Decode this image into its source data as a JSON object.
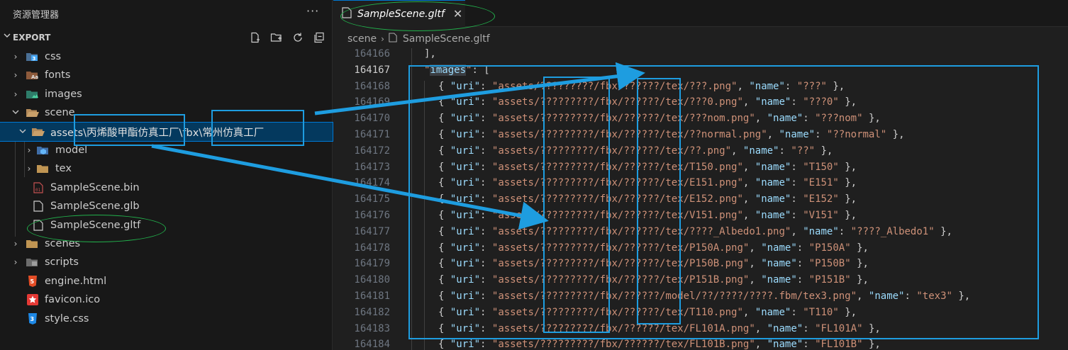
{
  "sidebar": {
    "title": "资源管理器",
    "more": "···",
    "section": "EXPORT",
    "items": [
      {
        "label": "css",
        "icon": "css-folder-icon",
        "indent": 0,
        "expanded": false
      },
      {
        "label": "fonts",
        "icon": "fonts-folder-icon",
        "indent": 0,
        "expanded": false
      },
      {
        "label": "images",
        "icon": "images-folder-icon",
        "indent": 0,
        "expanded": false
      },
      {
        "label": "scene",
        "icon": "folder-open-icon",
        "indent": 0,
        "expanded": true
      },
      {
        "label": "assets\\丙烯酸甲酯仿真工厂\\fbx\\常州仿真工厂",
        "icon": "folder-open-icon",
        "indent": 1,
        "expanded": true,
        "selected": true
      },
      {
        "label": "model",
        "icon": "model-folder-icon",
        "indent": 2,
        "expanded": false
      },
      {
        "label": "tex",
        "icon": "folder-icon",
        "indent": 2,
        "expanded": false
      },
      {
        "label": "SampleScene.bin",
        "icon": "binary-file-icon",
        "indent": 1
      },
      {
        "label": "SampleScene.glb",
        "icon": "file-icon",
        "indent": 1
      },
      {
        "label": "SampleScene.gltf",
        "icon": "file-icon",
        "indent": 1
      },
      {
        "label": "scenes",
        "icon": "folder-icon",
        "indent": 0,
        "expanded": false
      },
      {
        "label": "scripts",
        "icon": "scripts-folder-icon",
        "indent": 0,
        "expanded": false
      },
      {
        "label": "engine.html",
        "icon": "html-file-icon",
        "indent": 0
      },
      {
        "label": "favicon.ico",
        "icon": "favicon-star-icon",
        "indent": 0
      },
      {
        "label": "style.css",
        "icon": "css-file-icon",
        "indent": 0
      }
    ]
  },
  "editor": {
    "tab_label": "SampleScene.gltf",
    "breadcrumb": [
      "scene",
      "SampleScene.gltf"
    ],
    "lines": [
      {
        "n": "164166",
        "text": "],"
      },
      {
        "n": "164167",
        "text": "\"images\": [",
        "current": true
      },
      {
        "n": "164168",
        "uri": "assets/?????????/fbx/??????/tex/???.png",
        "name": "???"
      },
      {
        "n": "164169",
        "uri": "assets/?????????/fbx/??????/tex/???0.png",
        "name": "???0"
      },
      {
        "n": "164170",
        "uri": "assets/?????????/fbx/??????/tex/???nom.png",
        "name": "???nom"
      },
      {
        "n": "164171",
        "uri": "assets/?????????/fbx/??????/tex/??normal.png",
        "name": "??normal"
      },
      {
        "n": "164172",
        "uri": "assets/?????????/fbx/??????/tex/??.png",
        "name": "??"
      },
      {
        "n": "164173",
        "uri": "assets/?????????/fbx/??????/tex/T150.png",
        "name": "T150"
      },
      {
        "n": "164174",
        "uri": "assets/?????????/fbx/??????/tex/E151.png",
        "name": "E151"
      },
      {
        "n": "164175",
        "uri": "assets/?????????/fbx/??????/tex/E152.png",
        "name": "E152"
      },
      {
        "n": "164176",
        "uri": "assets/?????????/fbx/??????/tex/V151.png",
        "name": "V151"
      },
      {
        "n": "164177",
        "uri": "assets/?????????/fbx/??????/tex/????_Albedo1.png",
        "name": "????_Albedo1"
      },
      {
        "n": "164178",
        "uri": "assets/?????????/fbx/??????/tex/P150A.png",
        "name": "P150A"
      },
      {
        "n": "164179",
        "uri": "assets/?????????/fbx/??????/tex/P150B.png",
        "name": "P150B"
      },
      {
        "n": "164180",
        "uri": "assets/?????????/fbx/??????/tex/P151B.png",
        "name": "P151B"
      },
      {
        "n": "164181",
        "uri": "assets/?????????/fbx/??????/model/??/????/????.fbm/tex3.png",
        "name": "tex3"
      },
      {
        "n": "164182",
        "uri": "assets/?????????/fbx/??????/tex/T110.png",
        "name": "T110"
      },
      {
        "n": "164183",
        "uri": "assets/?????????/fbx/??????/tex/FL101A.png",
        "name": "FL101A"
      },
      {
        "n": "164184",
        "uri": "assets/?????????/fbx/??????/tex/FL101B.png",
        "name": "FL101B"
      }
    ]
  },
  "colors": {
    "annotation_box": "#1e9de0",
    "annotation_ellipse": "#22b14c",
    "selection": "#04395e"
  }
}
